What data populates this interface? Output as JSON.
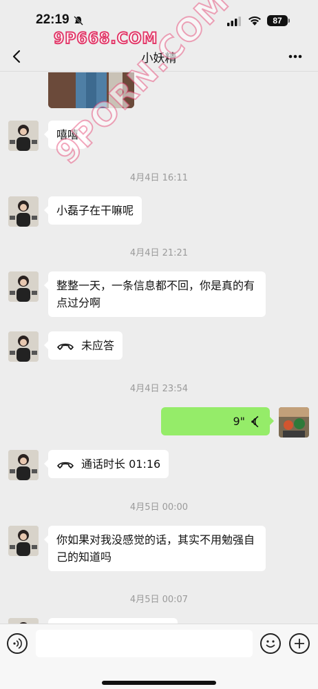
{
  "status_bar": {
    "time": "22:19",
    "battery": "87"
  },
  "nav": {
    "title": "小妖精"
  },
  "watermarks": {
    "top": "9P668.COM",
    "diagonal": "9PORN.COM"
  },
  "messages": [
    {
      "type": "text",
      "side": "left",
      "text": "嘻嘻"
    },
    {
      "type": "timestamp",
      "text": "4月4日 16:11"
    },
    {
      "type": "text",
      "side": "left",
      "text": "小磊子在干嘛呢"
    },
    {
      "type": "timestamp",
      "text": "4月4日 21:21"
    },
    {
      "type": "text",
      "side": "left",
      "text": "整整一天，一条信息都不回，你是真的有点过分啊"
    },
    {
      "type": "call",
      "side": "left",
      "text": "未应答"
    },
    {
      "type": "timestamp",
      "text": "4月4日 23:54"
    },
    {
      "type": "voice",
      "side": "right",
      "text": "9\""
    },
    {
      "type": "call",
      "side": "left",
      "text": "通话时长 01:16"
    },
    {
      "type": "timestamp",
      "text": "4月5日 00:00"
    },
    {
      "type": "text",
      "side": "left",
      "text": "你如果对我没感觉的话，其实不用勉强自己的知道吗"
    },
    {
      "type": "timestamp",
      "text": "4月5日 00:07"
    }
  ],
  "input": {
    "value": "",
    "placeholder": ""
  },
  "icons": {
    "back": "chevron-left-icon",
    "more": "more-icon",
    "voice_toggle": "voice-icon",
    "emoji": "emoji-icon",
    "plus": "plus-icon",
    "call": "phone-icon"
  },
  "colors": {
    "background": "#ededed",
    "bubble_left": "#ffffff",
    "bubble_right": "#95ec69",
    "timestamp": "#9a9a9a"
  }
}
